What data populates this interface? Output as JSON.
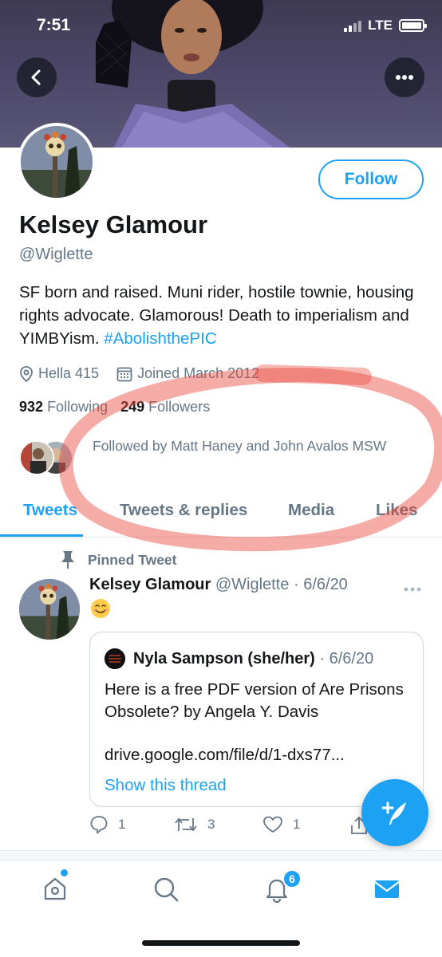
{
  "status_bar": {
    "time": "7:51",
    "network": "LTE"
  },
  "profile": {
    "name": "Kelsey Glamour",
    "handle": "@Wiglette",
    "follow_label": "Follow",
    "bio_text": "SF born and raised. Muni rider, hostile townie, housing rights advocate. Glamorous! Death to imperialism and YIMBYism.",
    "bio_hashtag": "#AbolishthePIC",
    "location": "Hella 415",
    "joined": "Joined March 2012",
    "following_count": "932",
    "following_label": "Following",
    "followers_count": "249",
    "followers_label": "Followers",
    "followed_by": "Followed by Matt Haney and John Avalos MSW"
  },
  "tabs": [
    {
      "label": "Tweets"
    },
    {
      "label": "Tweets & replies"
    },
    {
      "label": "Media"
    },
    {
      "label": "Likes"
    }
  ],
  "pinned_tweet": {
    "pinned_label": "Pinned Tweet",
    "author_name": "Kelsey Glamour",
    "author_handle": "@Wiglette",
    "date": "6/6/20",
    "emoji": "smiling-face",
    "quote": {
      "author_name": "Nyla Sampson (she/her)",
      "date": "6/6/20",
      "text": "Here is a free PDF version of Are Prisons Obsolete? by Angela Y. Davis",
      "link": "drive.google.com/file/d/1-dxs77...",
      "thread_label": "Show this thread"
    },
    "replies": "1",
    "retweets": "3",
    "likes": "1"
  },
  "bottom_tabs": {
    "notifications_badge": "6",
    "icons": [
      "home-icon",
      "search-icon",
      "bell-icon",
      "mail-icon"
    ]
  },
  "colors": {
    "accent": "#1da1f2",
    "annotation": "#e8463a"
  }
}
